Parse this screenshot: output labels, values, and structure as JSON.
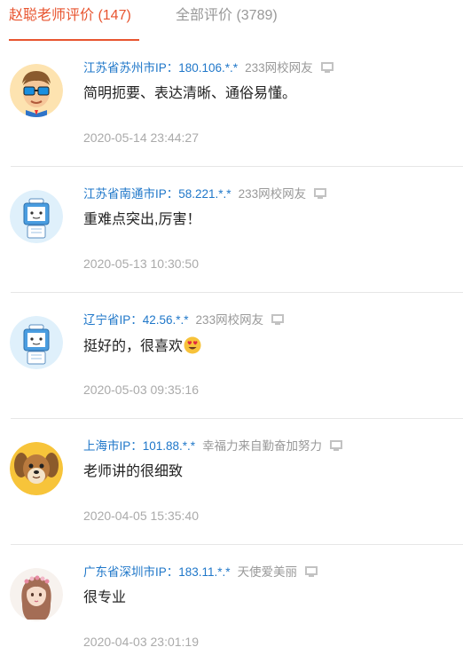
{
  "tabs": [
    {
      "label": "赵聪老师评价 (147)",
      "active": true
    },
    {
      "label": "全部评价 (3789)",
      "active": false
    }
  ],
  "colors": {
    "accent": "#e8542f",
    "location": "#1f77c9",
    "muted": "#999999"
  },
  "reviews": [
    {
      "location": "江苏省苏州市IP：180.106.*.*",
      "nickname": "233网校网友",
      "content": "简明扼要、表达清晰、通俗易懂。",
      "time": "2020-05-14 23:44:27",
      "avatar": "cartoon-man-avatar",
      "device": "pc-icon"
    },
    {
      "location": "江苏省南通市IP：58.221.*.*",
      "nickname": "233网校网友",
      "content": "重难点突出,厉害！",
      "time": "2020-05-13 10:30:50",
      "avatar": "robot-mascot-avatar",
      "device": "pc-icon"
    },
    {
      "location": "辽宁省IP：42.56.*.*",
      "nickname": "233网校网友",
      "content": "挺好的，很喜欢",
      "time": "2020-05-03 09:35:16",
      "avatar": "robot-mascot-avatar",
      "device": "pc-icon",
      "emoji": "heart-eyes-emoji"
    },
    {
      "location": "上海市IP：101.88.*.*",
      "nickname": "幸福力来自勤奋加努力",
      "content": "老师讲的很细致",
      "time": "2020-04-05 15:35:40",
      "avatar": "dog-avatar",
      "device": "pc-icon"
    },
    {
      "location": "广东省深圳市IP：183.11.*.*",
      "nickname": "天使爱美丽",
      "content": "很专业",
      "time": "2020-04-03 23:01:19",
      "avatar": "girl-avatar",
      "device": "pc-icon"
    }
  ]
}
